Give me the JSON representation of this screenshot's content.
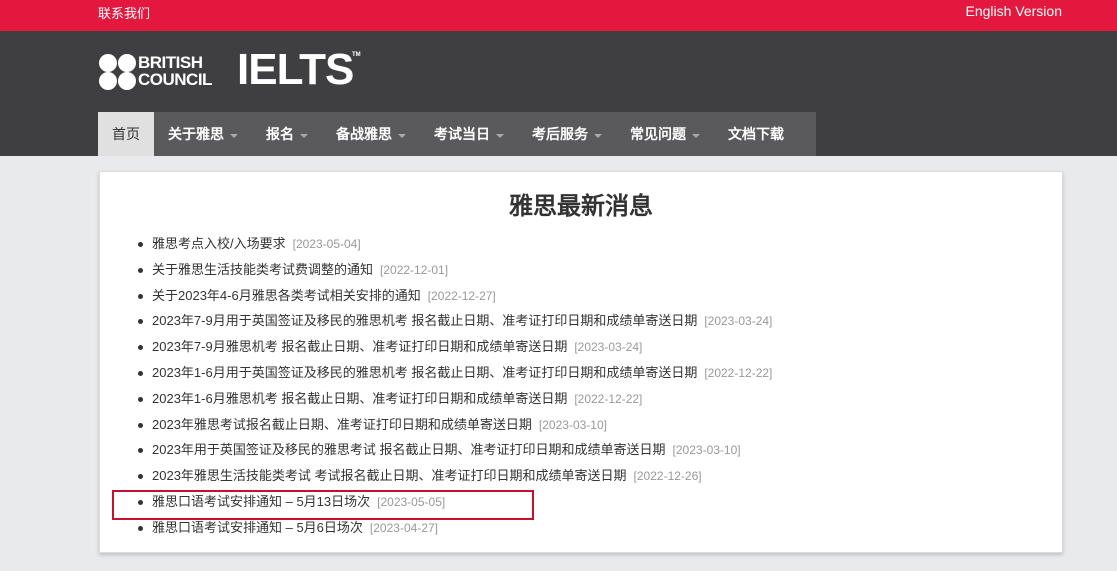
{
  "topbar": {
    "contact": "联系我们",
    "english": "English Version"
  },
  "logo": {
    "line1": "BRITISH",
    "line2": "COUNCIL",
    "brand": "IELTS",
    "tm": "TM"
  },
  "nav": [
    {
      "label": "首页",
      "active": true,
      "dropdown": false
    },
    {
      "label": "关于雅思",
      "active": false,
      "dropdown": true
    },
    {
      "label": "报名",
      "active": false,
      "dropdown": true
    },
    {
      "label": "备战雅思",
      "active": false,
      "dropdown": true
    },
    {
      "label": "考试当日",
      "active": false,
      "dropdown": true
    },
    {
      "label": "考后服务",
      "active": false,
      "dropdown": true
    },
    {
      "label": "常见问题",
      "active": false,
      "dropdown": true
    },
    {
      "label": "文档下载",
      "active": false,
      "dropdown": false
    }
  ],
  "main": {
    "title": "雅思最新消息",
    "news": [
      {
        "title": "雅思考点入校/入场要求",
        "date": "[2023-05-04]"
      },
      {
        "title": "关于雅思生活技能类考试费调整的通知",
        "date": "[2022-12-01]"
      },
      {
        "title": "关于2023年4-6月雅思各类考试相关安排的通知",
        "date": "[2022-12-27]"
      },
      {
        "title": "2023年7-9月用于英国签证及移民的雅思机考 报名截止日期、准考证打印日期和成绩单寄送日期",
        "date": "[2023-03-24]"
      },
      {
        "title": "2023年7-9月雅思机考 报名截止日期、准考证打印日期和成绩单寄送日期",
        "date": "[2023-03-24]"
      },
      {
        "title": "2023年1-6月用于英国签证及移民的雅思机考 报名截止日期、准考证打印日期和成绩单寄送日期",
        "date": "[2022-12-22]"
      },
      {
        "title": "2023年1-6月雅思机考 报名截止日期、准考证打印日期和成绩单寄送日期",
        "date": "[2022-12-22]"
      },
      {
        "title": "2023年雅思考试报名截止日期、准考证打印日期和成绩单寄送日期",
        "date": "[2023-03-10]"
      },
      {
        "title": "2023年用于英国签证及移民的雅思考试 报名截止日期、准考证打印日期和成绩单寄送日期",
        "date": "[2023-03-10]"
      },
      {
        "title": "2023年雅思生活技能类考试 考试报名截止日期、准考证打印日期和成绩单寄送日期",
        "date": "[2022-12-26]"
      },
      {
        "title": "雅思口语考试安排通知 – 5月13日场次",
        "date": "[2023-05-05]"
      },
      {
        "title": "雅思口语考试安排通知 – 5月6日场次",
        "date": "[2023-04-27]"
      }
    ]
  },
  "colors": {
    "topbar": "#e4173e",
    "header": "#3f3f42",
    "nav": "#5a5a5c",
    "highlight": "#c8102e"
  }
}
